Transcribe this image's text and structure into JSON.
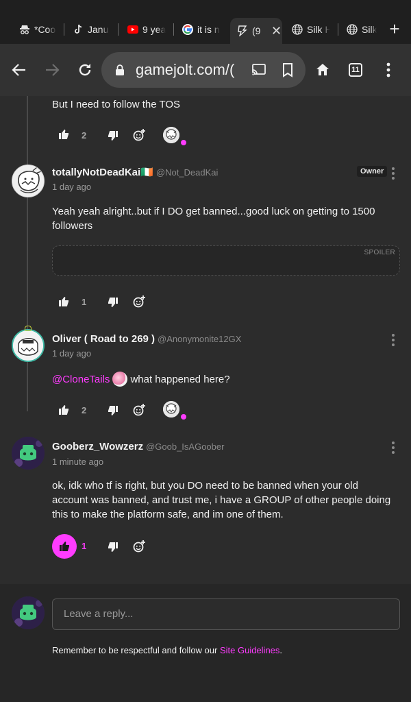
{
  "browser": {
    "tabs": [
      {
        "title": "*Cool",
        "icon": "incognito-icon"
      },
      {
        "title": "Janu",
        "icon": "tiktok-icon"
      },
      {
        "title": "9 yea",
        "icon": "youtube-icon"
      },
      {
        "title": "it is n",
        "icon": "google-icon"
      },
      {
        "title": "(9",
        "icon": "gamejolt-icon",
        "active": true
      },
      {
        "title": "Silk H",
        "icon": "globe-icon"
      },
      {
        "title": "Silk",
        "icon": "globe-icon"
      }
    ],
    "url": "gamejolt.com/(",
    "tab_count": "11"
  },
  "comments": [
    {
      "text": "But I need to follow the TOS",
      "likes": "2"
    },
    {
      "author": "totallyNotDeadKai",
      "flag": "🇮🇪",
      "handle": "@Not_DeadKai",
      "badge": "Owner",
      "time": "1 day ago",
      "text": "Yeah yeah alright..but if I DO get banned...good luck on getting to 1500 followers",
      "spoiler_label": "SPOILER",
      "likes": "1"
    },
    {
      "author": "Oliver ( Road to 269 )",
      "handle": "@Anonymonite12GX",
      "time": "1 day ago",
      "mention": "@CloneTails",
      "text": "what happened here?",
      "likes": "2"
    },
    {
      "author": "Gooberz_Wowzerz",
      "handle": "@Goob_IsAGoober",
      "time": "1 minute ago",
      "text": "ok, idk who tf is right, but you DO need to be banned when your old account was banned, and trust me, i have a GROUP of other people doing this to make the platform safe, and im one of them.",
      "likes": "1"
    }
  ],
  "reply": {
    "placeholder": "Leave a reply...",
    "guidelines_prefix": "Remember to be respectful and follow our ",
    "guidelines_link": "Site Guidelines",
    "guidelines_suffix": "."
  },
  "colors": {
    "accent": "#ff3cff",
    "background": "#2c2c2c",
    "toolbar": "#323232",
    "tabstrip": "#1f1f1f"
  }
}
